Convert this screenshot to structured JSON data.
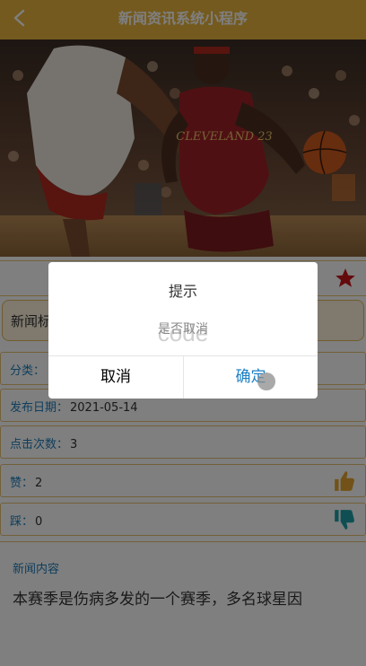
{
  "navbar": {
    "title": "新闻资讯系统小程序",
    "back_icon": "chevron-left-icon"
  },
  "hero": {
    "image": "basketball-game-photo",
    "jersey_text": "CLEVELAND 23"
  },
  "favorite": {
    "icon": "star-icon",
    "color": "#c8151b"
  },
  "news_title": "新闻标",
  "info": {
    "category": {
      "label": "分类：",
      "value": ""
    },
    "publish_date": {
      "label": "发布日期：",
      "value": "2021-05-14"
    },
    "clicks": {
      "label": "点击次数：",
      "value": "3"
    },
    "likes": {
      "label": "赞：",
      "value": "2",
      "icon": "thumbs-up-icon",
      "color": "#e4a52e"
    },
    "dislikes": {
      "label": "踩：",
      "value": "0",
      "icon": "thumbs-down-icon",
      "color": "#1f9fa8"
    }
  },
  "content": {
    "label": "新闻内容",
    "text": "本赛季是伤病多发的一个赛季，多名球星因"
  },
  "dialog": {
    "title": "提示",
    "message": "是否取消",
    "watermark": "code",
    "cancel_label": "取消",
    "confirm_label": "确定"
  },
  "colors": {
    "theme": "#e9b43c",
    "link": "#1f7db8",
    "confirm": "#1a7fc5"
  }
}
